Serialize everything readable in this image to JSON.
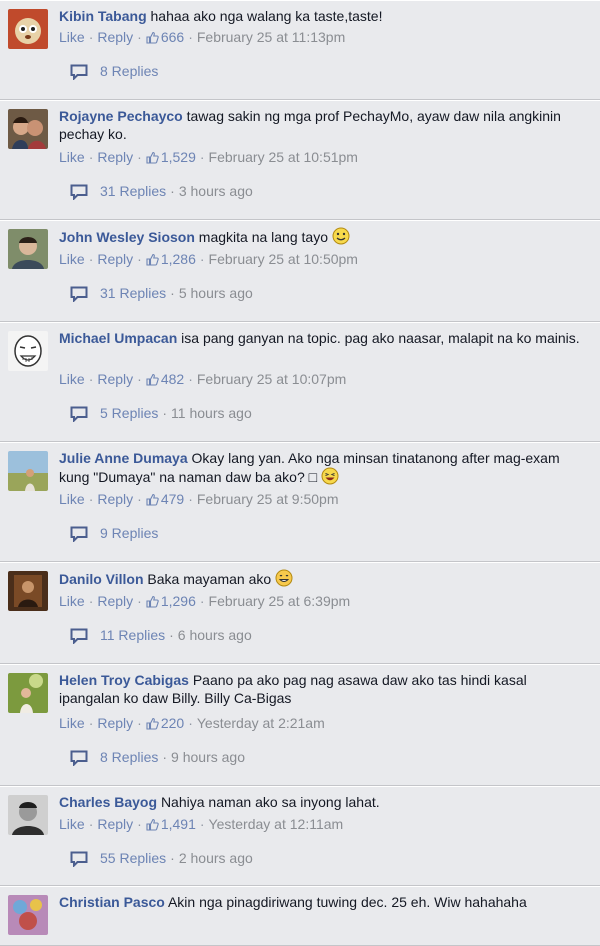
{
  "comments": [
    {
      "author": "Kibin Tabang",
      "text": "hahaa ako nga walang ka taste,taste!",
      "like": "Like",
      "reply": "Reply",
      "likes": "666",
      "time": "February 25 at 11:13pm",
      "replies": "8 Replies",
      "replies_time": "",
      "avatar_color": "#8a4b2a"
    },
    {
      "author": "Rojayne Pechayco",
      "text": "tawag sakin ng mga prof PechayMo, ayaw daw nila angkinin pechay ko.",
      "like": "Like",
      "reply": "Reply",
      "likes": "1,529",
      "time": "February 25 at 10:51pm",
      "replies": "31 Replies",
      "replies_time": "3 hours ago",
      "avatar_color": "#7a5a3f"
    },
    {
      "author": "John Wesley Sioson",
      "text": "magkita na lang tayo",
      "emoji": "smile",
      "like": "Like",
      "reply": "Reply",
      "likes": "1,286",
      "time": "February 25 at 10:50pm",
      "replies": "31 Replies",
      "replies_time": "5 hours ago",
      "avatar_color": "#5b6e4a"
    },
    {
      "author": "Michael Umpacan",
      "text": "isa pang ganyan na topic. pag ako naasar, malapit na ko mainis.",
      "like": "Like",
      "reply": "Reply",
      "likes": "482",
      "time": "February 25 at 10:07pm",
      "replies": "5 Replies",
      "replies_time": "11 hours ago",
      "avatar_color": "#f2f2f2"
    },
    {
      "author": "Julie Anne Dumaya",
      "text": "Okay lang yan. Ako nga minsan tinatanong after mag-exam kung \"Dumaya\" na naman daw ba ako? □",
      "emoji": "laugh",
      "like": "Like",
      "reply": "Reply",
      "likes": "479",
      "time": "February 25 at 9:50pm",
      "replies": "9 Replies",
      "replies_time": "",
      "avatar_color": "#8fae6a"
    },
    {
      "author": "Danilo Villon",
      "text": "Baka mayaman ako",
      "emoji": "grin",
      "like": "Like",
      "reply": "Reply",
      "likes": "1,296",
      "time": "February 25 at 6:39pm",
      "replies": "11 Replies",
      "replies_time": "6 hours ago",
      "avatar_color": "#5a3a22"
    },
    {
      "author": "Helen Troy Cabigas",
      "text": "Paano pa ako pag nag asawa daw ako tas hindi kasal ipangalan ko daw Billy. Billy Ca-Bigas",
      "like": "Like",
      "reply": "Reply",
      "likes": "220",
      "time": "Yesterday at 2:21am",
      "replies": "8 Replies",
      "replies_time": "9 hours ago",
      "avatar_color": "#6f8f3a"
    },
    {
      "author": "Charles Bayog",
      "text": "Nahiya naman ako sa inyong lahat.",
      "like": "Like",
      "reply": "Reply",
      "likes": "1,491",
      "time": "Yesterday at 12:11am",
      "replies": "55 Replies",
      "replies_time": "2 hours ago",
      "avatar_color": "#3a3a3a"
    },
    {
      "author": "Christian Pasco",
      "text": "Akin nga pinagdiriwang tuwing dec. 25 eh. Wiw hahahaha",
      "like": "",
      "reply": "",
      "likes": "",
      "time": "",
      "replies": "",
      "replies_time": "",
      "avatar_color": "#7a4a8a"
    }
  ]
}
